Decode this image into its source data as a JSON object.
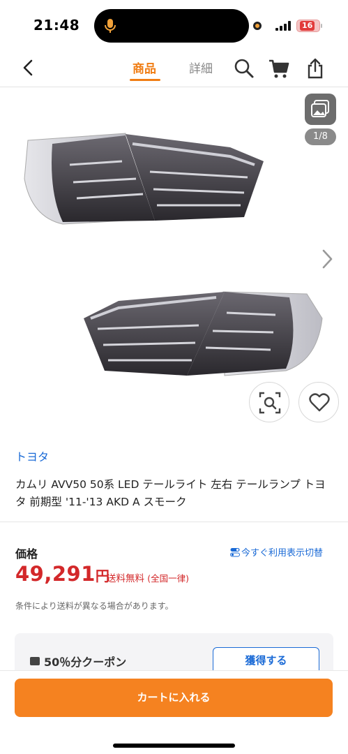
{
  "status_bar": {
    "time": "21:48",
    "battery_level": "16"
  },
  "nav": {
    "tabs": [
      {
        "label": "商品",
        "active": true
      },
      {
        "label": "詳細",
        "active": false
      }
    ],
    "icons": [
      "back-chevron-icon",
      "search-icon",
      "cart-icon",
      "share-icon"
    ]
  },
  "gallery": {
    "page_counter": "1/8",
    "icons": [
      "gallery-icon",
      "chevron-right-icon",
      "image-search-icon",
      "heart-icon"
    ]
  },
  "product": {
    "brand": "トヨタ",
    "title": "カムリ AVV50 50系 LED テールライト 左右 テールランプ トヨタ 前期型 '11-'13 AKD A スモーク"
  },
  "price": {
    "label": "価格",
    "switch_link": "今すぐ利用表示切替",
    "amount": "49,291",
    "currency": "円",
    "shipping": "送料無料",
    "shipping_note": "(全国一律)",
    "condition_note": "条件により送料が異なる場合があります。"
  },
  "coupon": {
    "label": "50％分クーポン",
    "button": "獲得する"
  },
  "cart_button": "カートに入れる",
  "colors": {
    "accent": "#f58220",
    "price": "#d3282a",
    "link": "#1a6ad6"
  }
}
